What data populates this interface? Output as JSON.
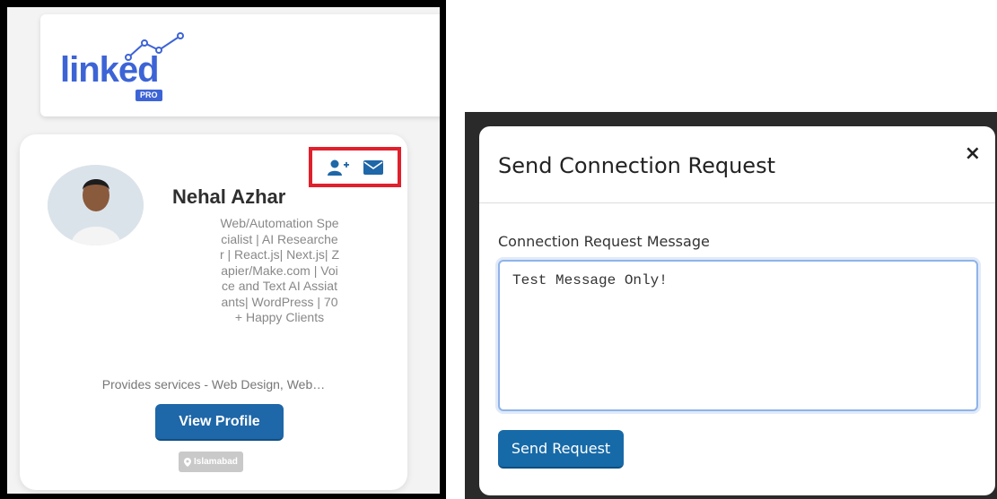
{
  "logo": {
    "word": "linked",
    "badge": "PRO"
  },
  "profile": {
    "name": "Nehal Azhar",
    "headline": "Web/Automation Specialist | AI Researcher | React.js| Next.js| Zapier/Make.com | Voice and Text AI Assiatants| WordPress | 70 + Happy Clients",
    "services": "Provides services - Web Design, Web…",
    "view_profile_label": "View Profile",
    "location": "Islamabad",
    "icons": {
      "connect": "user-plus-icon",
      "message": "envelope-icon",
      "location": "map-pin-icon"
    }
  },
  "modal": {
    "title": "Send Connection Request",
    "close_label": "×",
    "field_label": "Connection Request Message",
    "message_value": "Test Message Only! ",
    "send_label": "Send Request"
  },
  "colors": {
    "brand_blue": "#3d64d6",
    "button_blue": "#1e67a8",
    "highlight_red": "#e0202c"
  }
}
